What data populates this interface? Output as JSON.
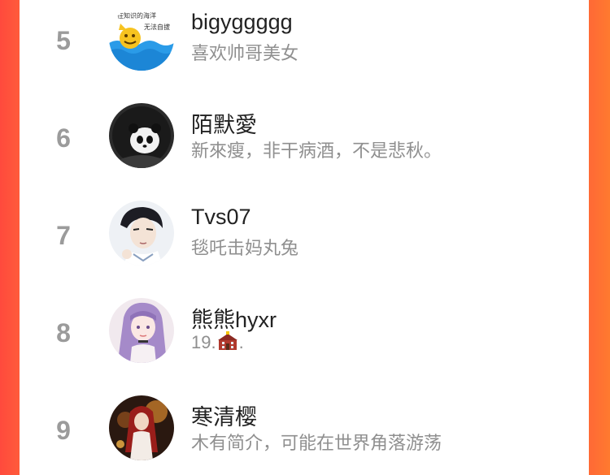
{
  "ranking": {
    "items": [
      {
        "rank": "5",
        "name": "bigyggggg",
        "bio": "喜欢帅哥美女",
        "avatar_text_1": "在知识的海洋",
        "avatar_text_2": "无法自拔"
      },
      {
        "rank": "6",
        "name": "陌默愛",
        "bio": "新來瘦，非干病酒，不是悲秋。"
      },
      {
        "rank": "7",
        "name": "Tvs07",
        "bio": "毯吒击妈丸兔"
      },
      {
        "rank": "8",
        "name": "熊熊hyxr",
        "bio_prefix": "19.",
        "bio_suffix": ".",
        "bio_icon": "school-building-emoji"
      },
      {
        "rank": "9",
        "name": "寒清樱",
        "bio": "木有简介，可能在世界角落游荡"
      }
    ]
  },
  "colors": {
    "background_left": "#ff4a3d",
    "background_right": "#ff7a2f",
    "rank": "#9b9b9b",
    "name": "#222222",
    "bio": "#8f8f8f"
  }
}
